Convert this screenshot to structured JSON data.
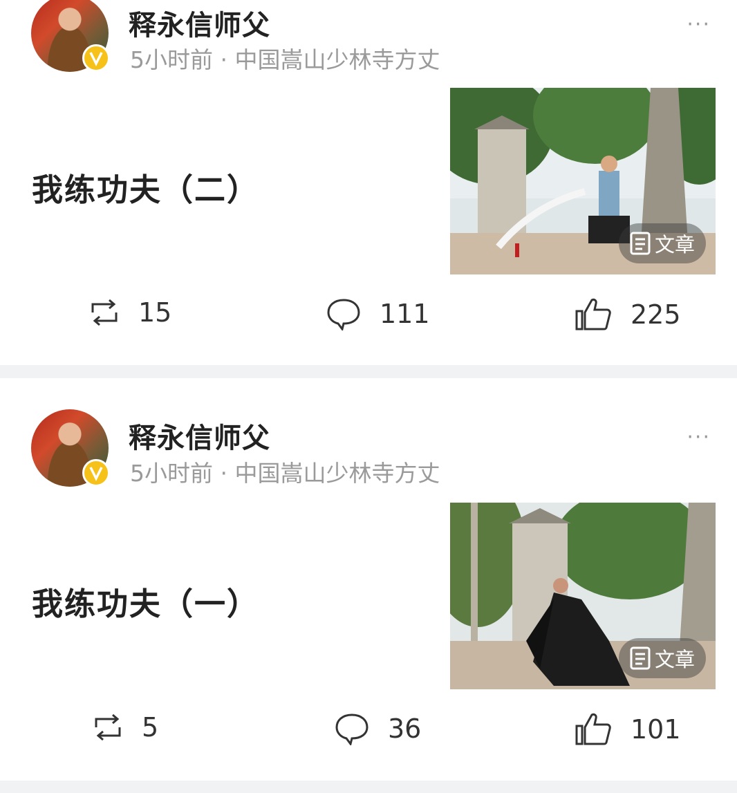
{
  "posts": [
    {
      "author": "释永信师父",
      "meta": "5小时前 · 中国嵩山少林寺方丈",
      "more": "···",
      "title": "我练功夫（二）",
      "tag": "文章",
      "reposts": "15",
      "comments": "111",
      "likes": "225"
    },
    {
      "author": "释永信师父",
      "meta": "5小时前 · 中国嵩山少林寺方丈",
      "more": "···",
      "title": "我练功夫（一）",
      "tag": "文章",
      "reposts": "5",
      "comments": "36",
      "likes": "101"
    }
  ],
  "colors": {
    "divider": "#f1f2f4",
    "badge": "#f6c21a",
    "meta": "#9a9a9a"
  },
  "icons": [
    "repost-icon",
    "comment-icon",
    "like-icon",
    "verified-badge-icon",
    "article-icon",
    "more-icon"
  ]
}
